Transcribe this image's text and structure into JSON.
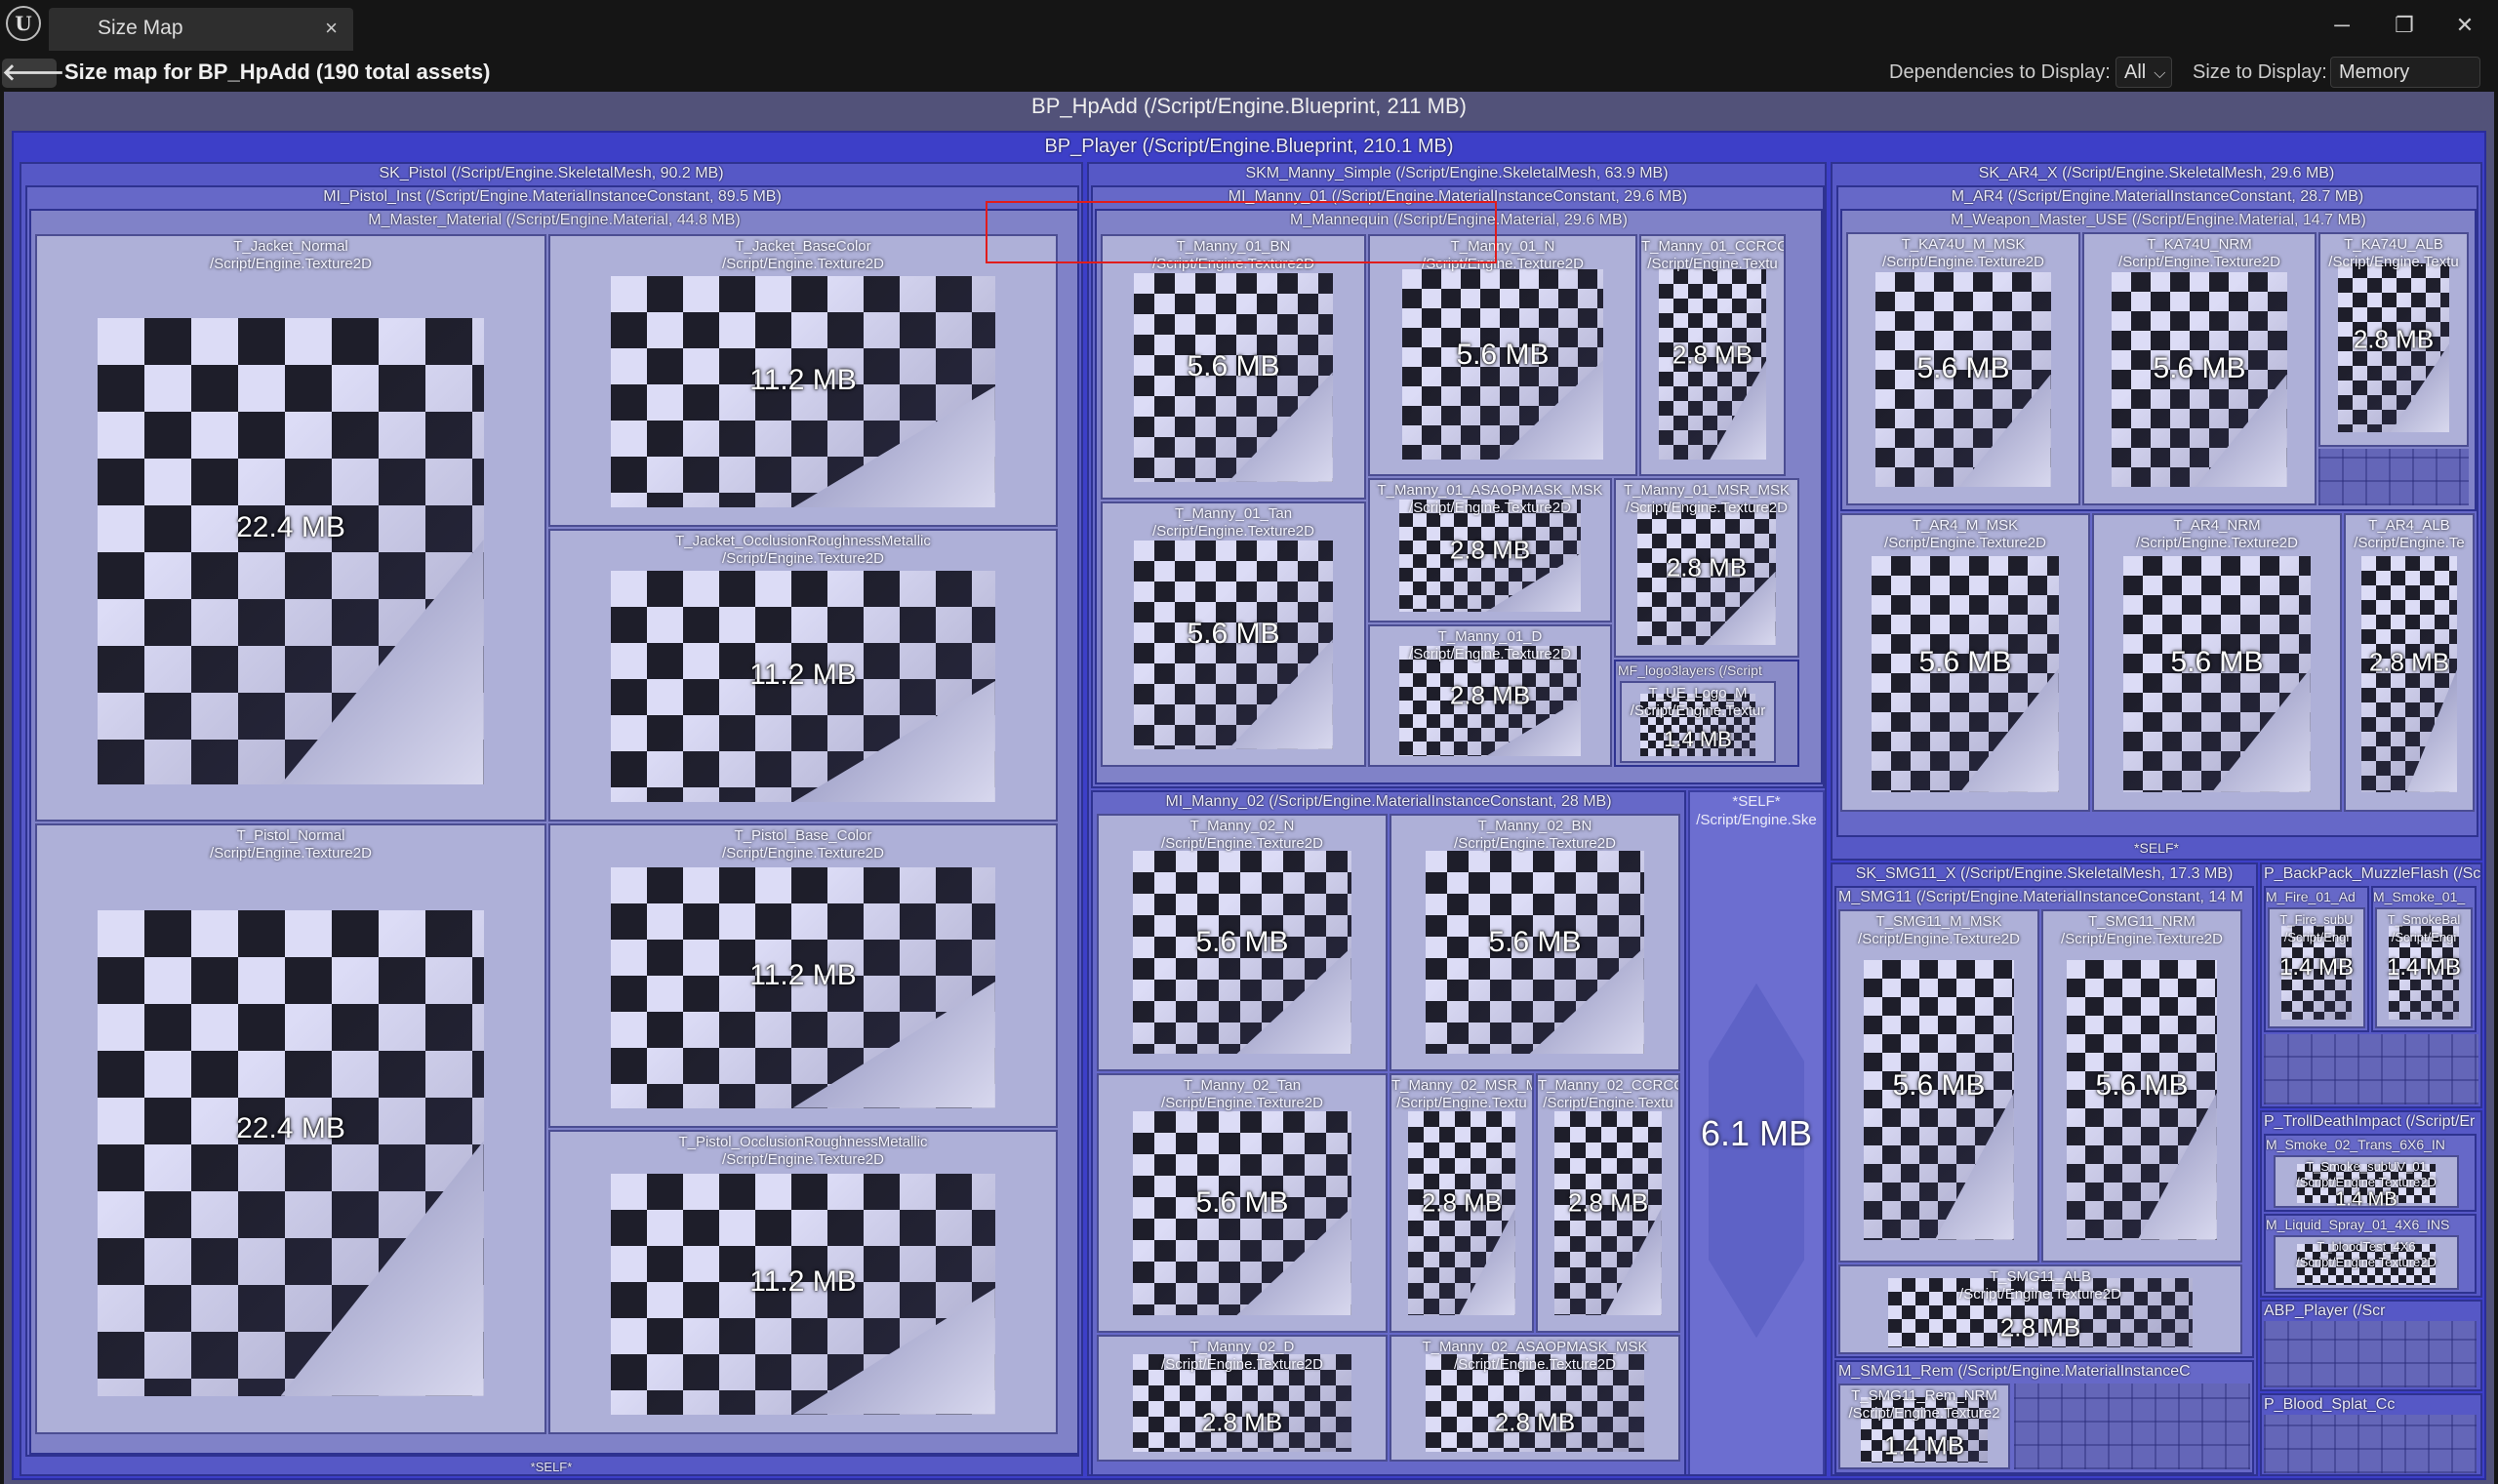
{
  "window": {
    "tab_title": "Size Map",
    "tab_close": "×",
    "minimize": "─",
    "maximize": "❐",
    "close": "✕",
    "logo": "U"
  },
  "header": {
    "back": "🡐",
    "title": "Size map for BP_HpAdd  (190 total assets)",
    "deps_label": "Dependencies to Display:",
    "deps_value": "All",
    "size_label": "Size to Display:",
    "size_value": "Memory Size",
    "chevron": "⌵"
  },
  "root": {
    "label": "BP_HpAdd  (/Script/Engine.Blueprint, 211 MB)"
  },
  "player": {
    "label": "BP_Player  (/Script/Engine.Blueprint, 210.1 MB)"
  },
  "pistol": {
    "label": "SK_Pistol  (/Script/Engine.SkeletalMesh, 90.2 MB)",
    "mi": "MI_Pistol_Inst  (/Script/Engine.MaterialInstanceConstant, 89.5 MB)",
    "mm": "M_Master_Material  (/Script/Engine.Material, 44.8 MB)",
    "self": "*SELF*",
    "tex": [
      {
        "name": "T_Jacket_Normal",
        "cls": "/Script/Engine.Texture2D",
        "size": "22.4 MB"
      },
      {
        "name": "T_Jacket_BaseColor",
        "cls": "/Script/Engine.Texture2D",
        "size": "11.2 MB"
      },
      {
        "name": "T_Jacket_OcclusionRoughnessMetallic",
        "cls": "/Script/Engine.Texture2D",
        "size": "11.2 MB"
      },
      {
        "name": "T_Pistol_Normal",
        "cls": "/Script/Engine.Texture2D",
        "size": "22.4 MB"
      },
      {
        "name": "T_Pistol_Base_Color",
        "cls": "/Script/Engine.Texture2D",
        "size": "11.2 MB"
      },
      {
        "name": "T_Pistol_OcclusionRoughnessMetallic",
        "cls": "/Script/Engine.Texture2D",
        "size": "11.2 MB"
      }
    ]
  },
  "manny": {
    "label": "SKM_Manny_Simple  (/Script/Engine.SkeletalMesh, 63.9 MB)",
    "mi1": "MI_Manny_01  (/Script/Engine.MaterialInstanceConstant, 29.6 MB)",
    "mm": "M_Mannequin  (/Script/Engine.Material, 29.6 MB)",
    "mi2": "MI_Manny_02  (/Script/Engine.MaterialInstanceConstant, 28 MB)",
    "self_label": "*SELF*",
    "self_cls": "/Script/Engine.Ske",
    "self_size": "6.1 MB",
    "mf": "MF_logo3layers  (/Script",
    "tex": [
      {
        "name": "T_Manny_01_BN",
        "cls": "/Script/Engine.Texture2D",
        "size": "5.6 MB"
      },
      {
        "name": "T_Manny_01_N",
        "cls": "/Script/Engine.Texture2D",
        "size": "5.6 MB"
      },
      {
        "name": "T_Manny_01_CCRCC",
        "cls": "/Script/Engine.Textu",
        "size": "2.8 MB"
      },
      {
        "name": "T_Manny_01_Tan",
        "cls": "/Script/Engine.Texture2D",
        "size": "5.6 MB"
      },
      {
        "name": "T_Manny_01_ASAOPMASK_MSK",
        "cls": "/Script/Engine.Texture2D",
        "size": "2.8 MB"
      },
      {
        "name": "T_Manny_01_MSR_MSK",
        "cls": "/Script/Engine.Texture2D",
        "size": "2.8 MB"
      },
      {
        "name": "T_Manny_01_D",
        "cls": "/Script/Engine.Texture2D",
        "size": "2.8 MB"
      },
      {
        "name": "T_UE_Logo_M",
        "cls": "/Script/Engine.Textur",
        "size": "1.4 MB"
      },
      {
        "name": "T_Manny_02_N",
        "cls": "/Script/Engine.Texture2D",
        "size": "5.6 MB"
      },
      {
        "name": "T_Manny_02_BN",
        "cls": "/Script/Engine.Texture2D",
        "size": "5.6 MB"
      },
      {
        "name": "T_Manny_02_Tan",
        "cls": "/Script/Engine.Texture2D",
        "size": "5.6 MB"
      },
      {
        "name": "T_Manny_02_MSR_M",
        "cls": "/Script/Engine.Textu",
        "size": "2.8 MB"
      },
      {
        "name": "T_Manny_02_CCRCC",
        "cls": "/Script/Engine.Textu",
        "size": "2.8 MB"
      },
      {
        "name": "T_Manny_02_D",
        "cls": "/Script/Engine.Texture2D",
        "size": "2.8 MB"
      },
      {
        "name": "T_Manny_02_ASAOPMASK_MSK",
        "cls": "/Script/Engine.Texture2D",
        "size": "2.8 MB"
      }
    ]
  },
  "ar4": {
    "label": "SK_AR4_X  (/Script/Engine.SkeletalMesh, 29.6 MB)",
    "mi": "M_AR4  (/Script/Engine.MaterialInstanceConstant, 28.7 MB)",
    "mm": "M_Weapon_Master_USE  (/Script/Engine.Material, 14.7 MB)",
    "self": "*SELF*",
    "tex": [
      {
        "name": "T_KA74U_M_MSK",
        "cls": "/Script/Engine.Texture2D",
        "size": "5.6 MB"
      },
      {
        "name": "T_KA74U_NRM",
        "cls": "/Script/Engine.Texture2D",
        "size": "5.6 MB"
      },
      {
        "name": "T_KA74U_ALB",
        "cls": "/Script/Engine.Textu",
        "size": "2.8 MB"
      },
      {
        "name": "T_AR4_M_MSK",
        "cls": "/Script/Engine.Texture2D",
        "size": "5.6 MB"
      },
      {
        "name": "T_AR4_NRM",
        "cls": "/Script/Engine.Texture2D",
        "size": "5.6 MB"
      },
      {
        "name": "T_AR4_ALB",
        "cls": "/Script/Engine.Te",
        "size": "2.8 MB"
      }
    ]
  },
  "smg": {
    "label": "SK_SMG11_X  (/Script/Engine.SkeletalMesh, 17.3 MB)",
    "mi": "M_SMG11  (/Script/Engine.MaterialInstanceConstant, 14 M",
    "rem": "M_SMG11_Rem  (/Script/Engine.MaterialInstanceC",
    "tex": [
      {
        "name": "T_SMG11_M_MSK",
        "cls": "/Script/Engine.Texture2D",
        "size": "5.6 MB"
      },
      {
        "name": "T_SMG11_NRM",
        "cls": "/Script/Engine.Texture2D",
        "size": "5.6 MB"
      },
      {
        "name": "T_SMG11_ALB",
        "cls": "/Script/Engine.Texture2D",
        "size": "2.8 MB"
      },
      {
        "name": "T_SMG11_Rem_NRM",
        "cls": "/Script/Engine.Texture2",
        "size": "1.4 MB"
      }
    ]
  },
  "backpack": {
    "label": "P_BackPack_MuzzleFlash  (/Scr",
    "fire": "M_Fire_01_Ad",
    "smoke": "M_Smoke_01_",
    "tex": [
      {
        "name": "T_Fire_subU",
        "cls": "/Script/Engi",
        "size": "1.4 MB"
      },
      {
        "name": "T_SmokeBal",
        "cls": "/Script/Engi",
        "size": "1.4 MB"
      }
    ]
  },
  "troll": {
    "label": "P_TrollDeathImpact  (/Script/Er",
    "smoke2": "M_Smoke_02_Trans_6X6_IN",
    "liquid": "M_Liquid_Spray_01_4X6_INS",
    "tex": [
      {
        "name": "T_Smoke_subUV_01",
        "cls": "/Script/Engine.Texture2D",
        "size": "1.4 MB"
      },
      {
        "name": "T_bloodTest_4X6",
        "cls": "/Script/Engine.Texture2D",
        "size": ""
      }
    ]
  },
  "abp": {
    "label": "ABP_Player  (/Scr"
  },
  "blood": {
    "label": "P_Blood_Splat_Cc"
  }
}
